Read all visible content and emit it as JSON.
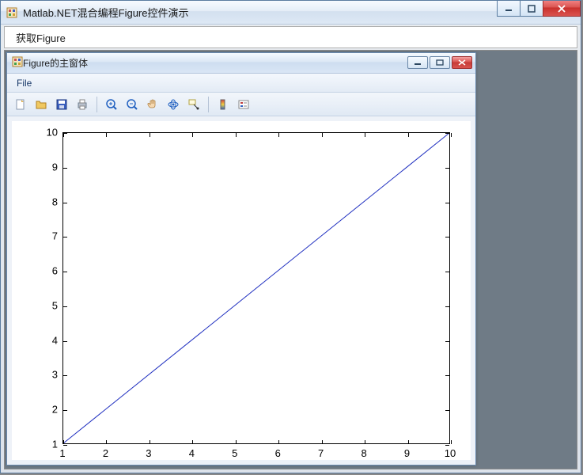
{
  "outer": {
    "title": "Matlab.NET混合编程Figure控件演示",
    "menu": {
      "get_figure": "获取Figure"
    }
  },
  "child": {
    "title": "Figure的主窗体",
    "menu": {
      "file": "File"
    }
  },
  "toolbar_icons": {
    "new": "new-file-icon",
    "open": "open-folder-icon",
    "save": "save-icon",
    "print": "print-icon",
    "zoom_in": "zoom-in-icon",
    "zoom_out": "zoom-out-icon",
    "pan": "pan-hand-icon",
    "rotate": "rotate-3d-icon",
    "data_cursor": "data-cursor-icon",
    "colorbar": "insert-colorbar-icon",
    "legend": "insert-legend-icon"
  },
  "chart_data": {
    "type": "line",
    "x": [
      1,
      2,
      3,
      4,
      5,
      6,
      7,
      8,
      9,
      10
    ],
    "y": [
      1,
      2,
      3,
      4,
      5,
      6,
      7,
      8,
      9,
      10
    ],
    "series": [
      {
        "name": "",
        "color": "#2030c0"
      }
    ],
    "title": "",
    "xlabel": "",
    "ylabel": "",
    "xlim": [
      1,
      10
    ],
    "ylim": [
      1,
      10
    ],
    "xticks": [
      1,
      2,
      3,
      4,
      5,
      6,
      7,
      8,
      9,
      10
    ],
    "yticks": [
      1,
      2,
      3,
      4,
      5,
      6,
      7,
      8,
      9,
      10
    ]
  }
}
